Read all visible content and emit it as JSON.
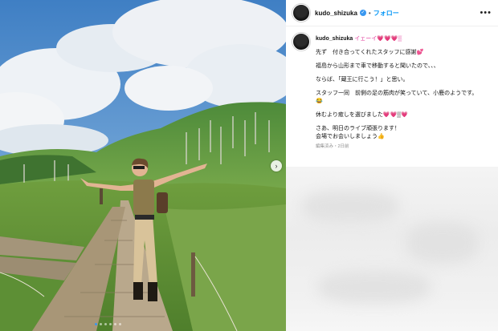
{
  "post": {
    "username": "kudo_shizuka",
    "verified_mark": "✓",
    "separator": "•",
    "follow_label": "フォロー",
    "more_icon": "more-horizontal-icon"
  },
  "caption": {
    "username": "kudo_shizuka",
    "first_line": "イェーイ💗💗💗▒",
    "lines": [
      "先ず　付き合ってくれたスタッフに感謝💕",
      "福島から山形まで車で移動すると聞いたので、、、",
      "ならば、「蔵王に行こう！」と思い。",
      "スタッフ一同　前側の足の筋肉が笑っていて、小鹿のようです。",
      "😂",
      "休むより癒しを選びました💗💗▒💗",
      "さあ、明日のライブ頑張ります！",
      "会場でお会いしましょう👍"
    ],
    "meta": "編集済み・2日前"
  },
  "carousel": {
    "next_icon": "›",
    "slide_count": 6,
    "active_slide": 1
  }
}
